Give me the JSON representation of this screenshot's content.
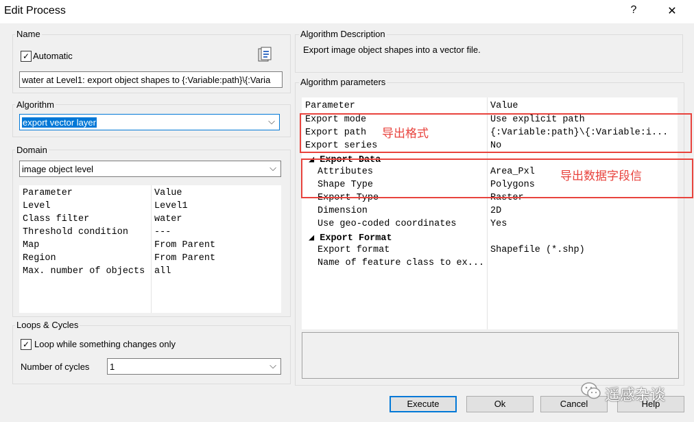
{
  "window": {
    "title": "Edit Process",
    "help_glyph": "?",
    "close_glyph": "✕"
  },
  "name_group": {
    "label": "Name",
    "automatic_label": "Automatic",
    "automatic_checked": true,
    "name_value": "water at  Level1: export object shapes to {:Variable:path}\\{:Varia"
  },
  "algorithm_group": {
    "label": "Algorithm",
    "selected": "export vector layer"
  },
  "domain_group": {
    "label": "Domain",
    "selected": "image object level",
    "header": {
      "param": "Parameter",
      "value": "Value"
    },
    "rows": [
      {
        "param": "Level",
        "value": "Level1"
      },
      {
        "param": "Class filter",
        "value": "water"
      },
      {
        "param": "Threshold condition",
        "value": "---"
      },
      {
        "param": "Map",
        "value": "From Parent"
      },
      {
        "param": "Region",
        "value": "From Parent"
      },
      {
        "param": "Max. number of objects",
        "value": "all"
      }
    ]
  },
  "loops_group": {
    "label": "Loops & Cycles",
    "loop_label": "Loop while something changes only",
    "loop_checked": true,
    "cycles_label": "Number of cycles",
    "cycles_value": "1"
  },
  "description_group": {
    "label": "Algorithm Description",
    "text": "Export image object shapes into a vector file."
  },
  "params_group": {
    "label": "Algorithm parameters",
    "header": {
      "param": "Parameter",
      "value": "Value"
    },
    "rows": [
      {
        "param": "Export mode",
        "value": "Use explicit path"
      },
      {
        "param": "Export path",
        "value": "{:Variable:path}\\{:Variable:i..."
      },
      {
        "param": "Export series",
        "value": "No"
      },
      {
        "section": "Export Data"
      },
      {
        "param": "Attributes",
        "value": "Area_Pxl",
        "indent": true
      },
      {
        "param": "Shape Type",
        "value": "Polygons",
        "indent": true
      },
      {
        "param": "Export Type",
        "value": "Raster",
        "indent": true
      },
      {
        "param": "Dimension",
        "value": "2D",
        "indent": true
      },
      {
        "param": "Use geo-coded coordinates",
        "value": "Yes",
        "indent": true
      },
      {
        "section": "Export Format"
      },
      {
        "param": "Export format",
        "value": "Shapefile (*.shp)",
        "indent": true
      },
      {
        "param": "Name of feature class to ex...",
        "value": "",
        "indent": true
      }
    ]
  },
  "annotations": {
    "format_note": "导出格式",
    "fields_note": "导出数据字段信"
  },
  "buttons": {
    "execute": "Execute",
    "ok": "Ok",
    "cancel": "Cancel",
    "help": "Help"
  },
  "watermark": "遥感杂谈",
  "colors": {
    "annotation_red": "#e8423c",
    "selection_blue": "#0078d7"
  }
}
